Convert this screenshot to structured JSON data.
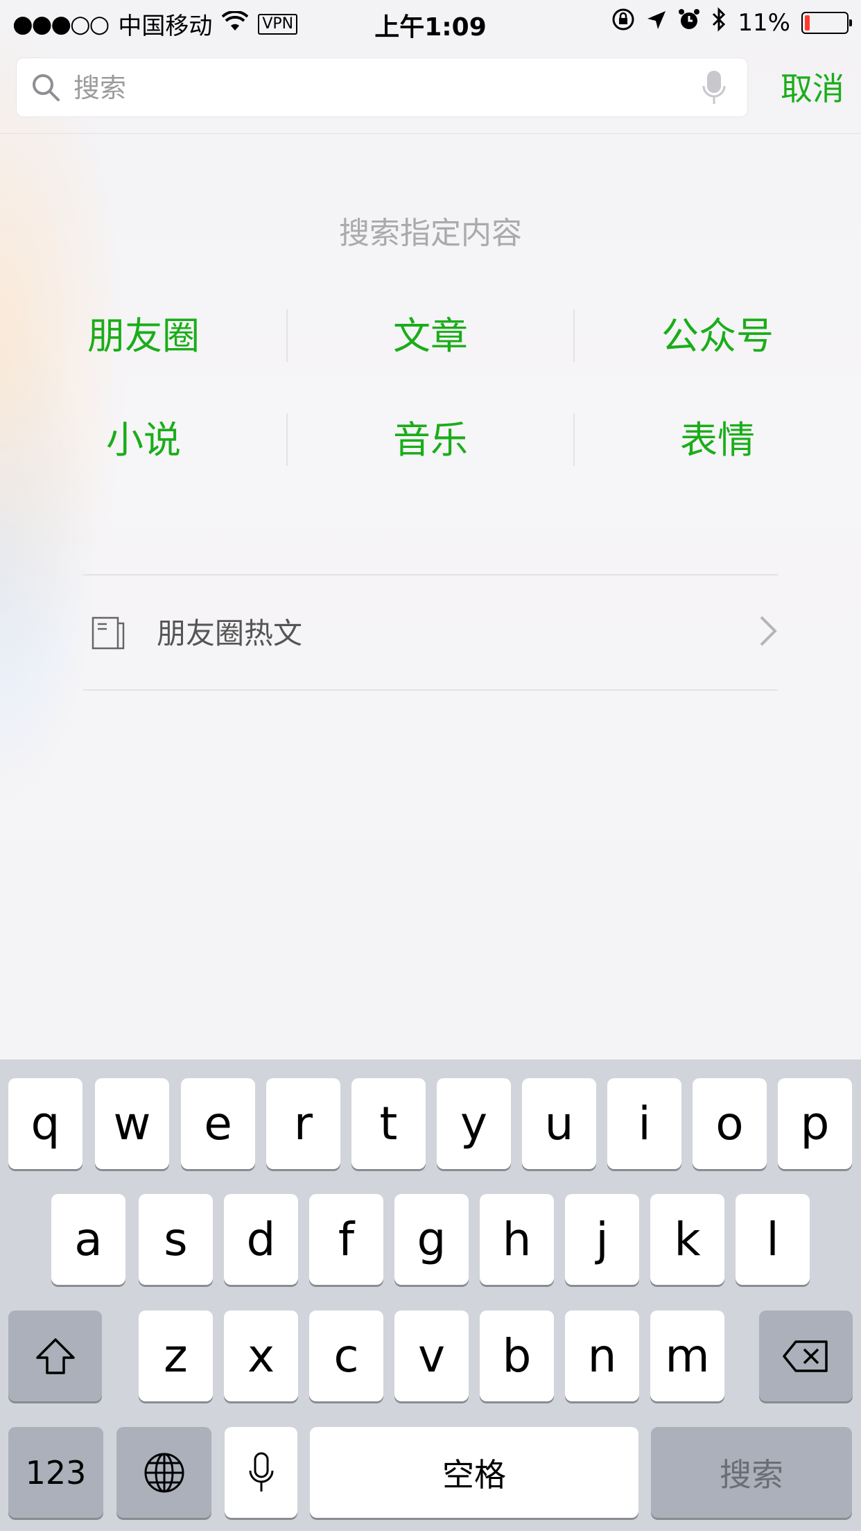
{
  "status_bar": {
    "signal": "●●●○○",
    "carrier": "中国移动",
    "vpn": "VPN",
    "time": "上午1:09",
    "battery_percent": "11%",
    "battery_level": 0.11,
    "icons": [
      "signal-icon",
      "wifi-icon",
      "orientation-lock-icon",
      "location-icon",
      "alarm-icon",
      "bluetooth-icon",
      "battery-icon"
    ]
  },
  "search": {
    "placeholder": "搜索",
    "value": "",
    "cancel_label": "取消"
  },
  "main": {
    "section_title": "搜索指定内容",
    "categories": [
      [
        "朋友圈",
        "文章",
        "公众号"
      ],
      [
        "小说",
        "音乐",
        "表情"
      ]
    ],
    "hot_item": {
      "label": "朋友圈热文",
      "icon": "article-icon"
    }
  },
  "keyboard": {
    "row1": [
      "q",
      "w",
      "e",
      "r",
      "t",
      "y",
      "u",
      "i",
      "o",
      "p"
    ],
    "row2": [
      "a",
      "s",
      "d",
      "f",
      "g",
      "h",
      "j",
      "k",
      "l"
    ],
    "row3": [
      "z",
      "x",
      "c",
      "v",
      "b",
      "n",
      "m"
    ],
    "numbers_label": "123",
    "space_label": "空格",
    "search_label": "搜索"
  },
  "colors": {
    "accent": "#1aad19",
    "keyboard_bg": "#d1d4da",
    "dark_key": "#abb0ba"
  }
}
